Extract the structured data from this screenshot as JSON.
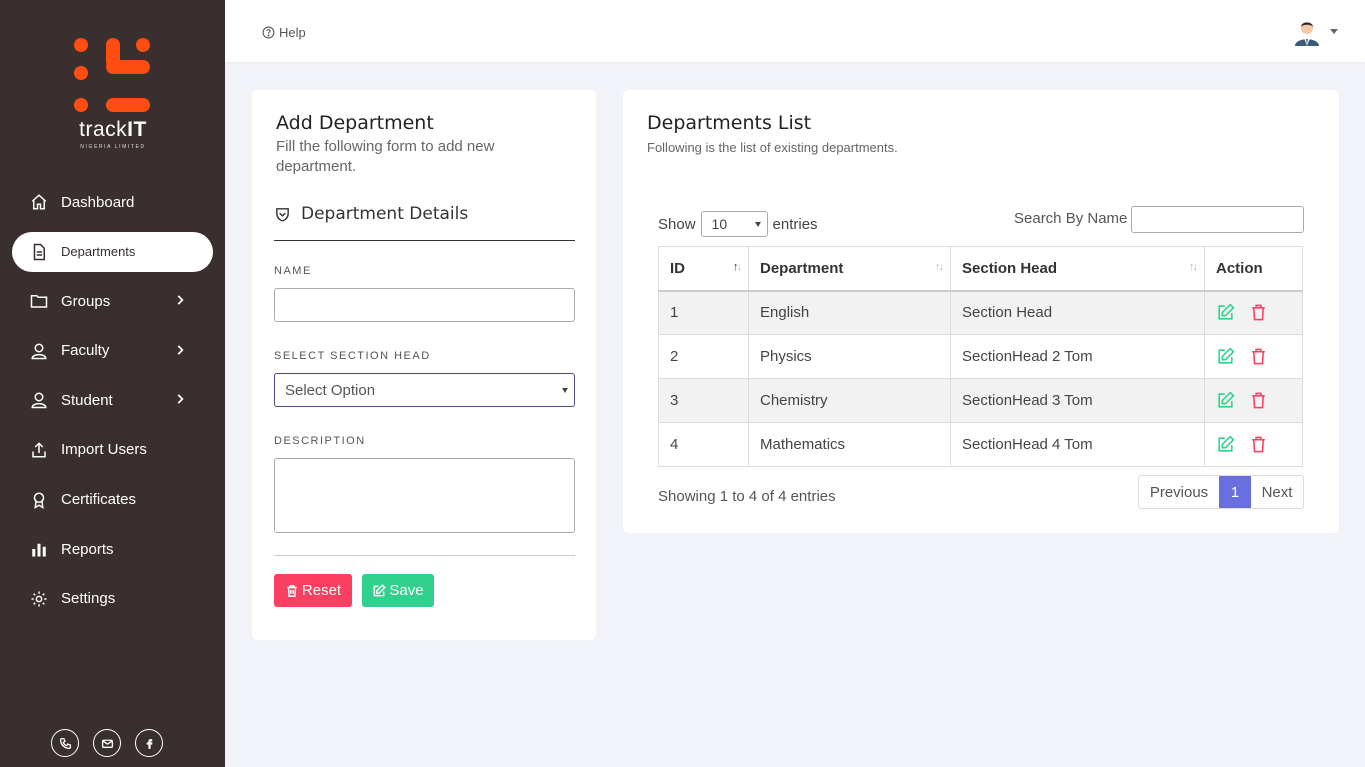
{
  "brand": {
    "name_light": "track",
    "name_bold": "IT",
    "tagline": "NIGERIA LIMITED",
    "logo_color": "#ff4d12"
  },
  "sidebar": {
    "items": [
      {
        "label": "Dashboard",
        "icon": "home-icon"
      },
      {
        "label": "Departments",
        "icon": "document-icon",
        "active": true
      },
      {
        "label": "Groups",
        "icon": "folder-icon",
        "has_submenu": true
      },
      {
        "label": "Faculty",
        "icon": "user-icon",
        "has_submenu": true
      },
      {
        "label": "Student",
        "icon": "user-icon",
        "has_submenu": true
      },
      {
        "label": "Import Users",
        "icon": "upload-icon"
      },
      {
        "label": "Certificates",
        "icon": "award-icon"
      },
      {
        "label": "Reports",
        "icon": "bar-chart-icon"
      },
      {
        "label": "Settings",
        "icon": "gear-icon"
      }
    ],
    "social": [
      "phone-icon",
      "mail-icon",
      "facebook-icon"
    ]
  },
  "header": {
    "help_label": "Help"
  },
  "add_form": {
    "title": "Add Department",
    "subtitle": "Fill the following form to add new department.",
    "section_title": "Department Details",
    "name_label": "NAME",
    "name_value": "",
    "section_head_label": "SELECT SECTION HEAD",
    "section_head_value": "Select Option",
    "description_label": "DESCRIPTION",
    "description_value": "",
    "reset_label": "Reset",
    "save_label": "Save",
    "reset_color": "#fb3f60",
    "save_color": "#2fd18c"
  },
  "list": {
    "title": "Departments List",
    "subtitle": "Following is the list of existing departments.",
    "show_label": "Show",
    "page_length": "10",
    "entries_label": "entries",
    "search_label": "Search By Name",
    "columns": [
      "ID",
      "Department",
      "Section Head",
      "Action"
    ],
    "rows": [
      {
        "id": "1",
        "department": "English",
        "section_head": "Section Head"
      },
      {
        "id": "2",
        "department": "Physics",
        "section_head": "SectionHead 2 Tom"
      },
      {
        "id": "3",
        "department": "Chemistry",
        "section_head": "SectionHead 3 Tom"
      },
      {
        "id": "4",
        "department": "Mathematics",
        "section_head": "SectionHead 4 Tom"
      }
    ],
    "info": "Showing 1 to 4 of 4 entries",
    "pager": {
      "previous": "Previous",
      "current": "1",
      "next": "Next"
    },
    "edit_color": "#2fd18c",
    "delete_color": "#fb3f60",
    "accent": "#6a6fe0"
  }
}
